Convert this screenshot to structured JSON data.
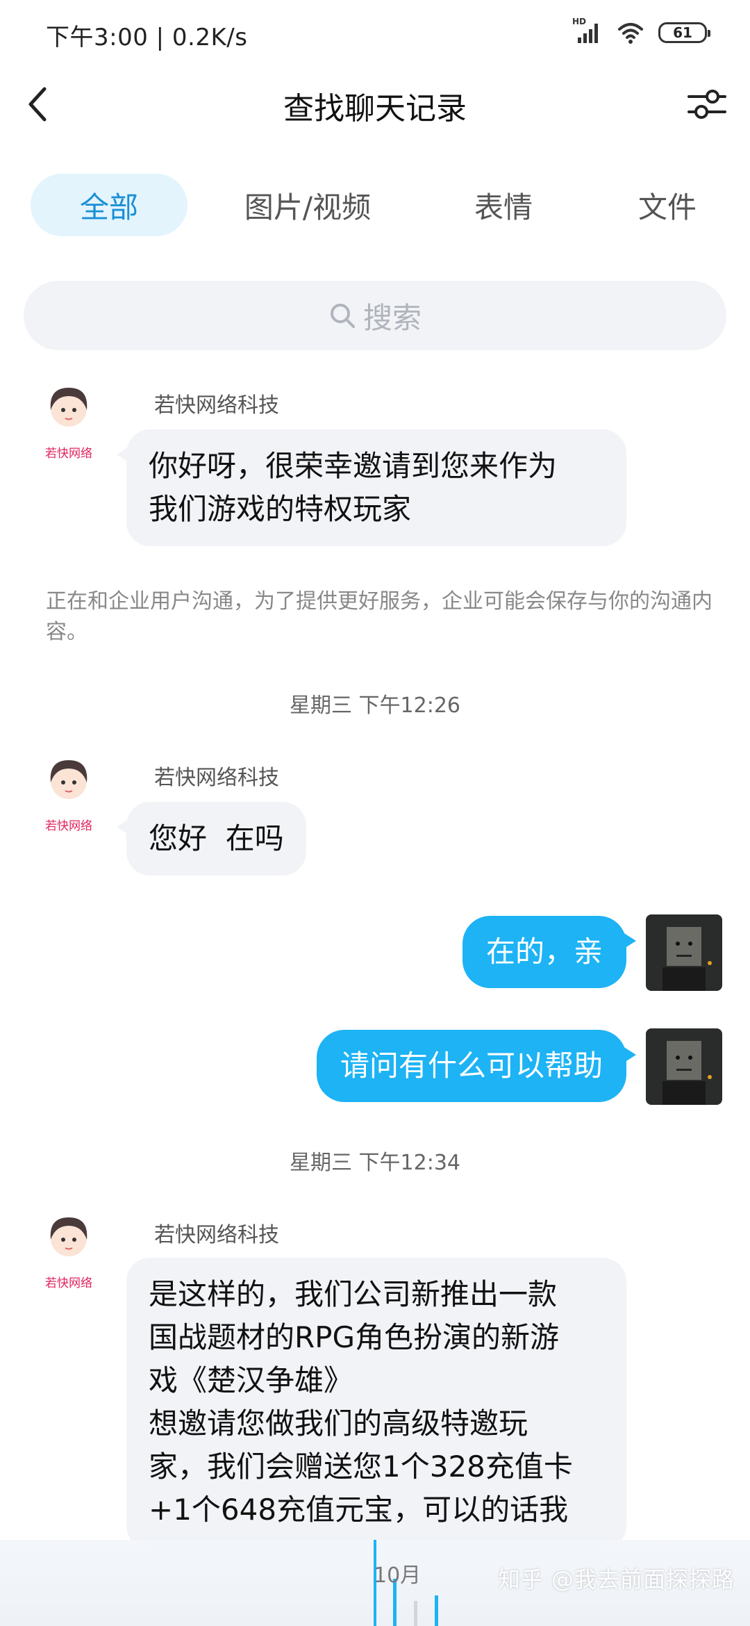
{
  "status_bar": {
    "time_speed": "下午3:00 | 0.2K/s",
    "signal_label": "HD",
    "battery": "61"
  },
  "nav": {
    "title": "查找聊天记录"
  },
  "tabs": [
    {
      "label": "全部",
      "active": true
    },
    {
      "label": "图片/视频",
      "active": false
    },
    {
      "label": "表情",
      "active": false
    },
    {
      "label": "文件",
      "active": false
    }
  ],
  "search": {
    "placeholder": "搜索"
  },
  "messages": {
    "m1": {
      "sender": "若快网络科技",
      "avatar_label": "若快网络",
      "line1": "你好呀，很荣幸邀请到您来作为",
      "line2": "我们游戏的特权玩家"
    },
    "notice": "正在和企业用户沟通，为了提供更好服务，企业可能会保存与你的沟通内容。",
    "time1": "星期三 下午12:26",
    "m2": {
      "sender": "若快网络科技",
      "avatar_label": "若快网络",
      "text": "您好  在吗"
    },
    "m3": {
      "text": "在的，亲"
    },
    "m4": {
      "text": "请问有什么可以帮助"
    },
    "time2": "星期三 下午12:34",
    "m5": {
      "sender": "若快网络科技",
      "avatar_label": "若快网络",
      "lines": [
        "是这样的，我们公司新推出一款",
        "国战题材的RPG角色扮演的新游",
        "戏《楚汉争雄》",
        "想邀请您做我们的高级特邀玩",
        "家，我们会赠送您1个328充值卡",
        "+1个648充值元宝，可以的话我"
      ]
    }
  },
  "bottom": {
    "month": "10月",
    "watermark": "知乎 @我去前面探探路"
  },
  "colors": {
    "accent": "#1db3f5",
    "tab_active_bg": "#e3f4fd",
    "tab_active_text": "#1a8fd6",
    "bubble_in_bg": "#f2f3f7"
  }
}
